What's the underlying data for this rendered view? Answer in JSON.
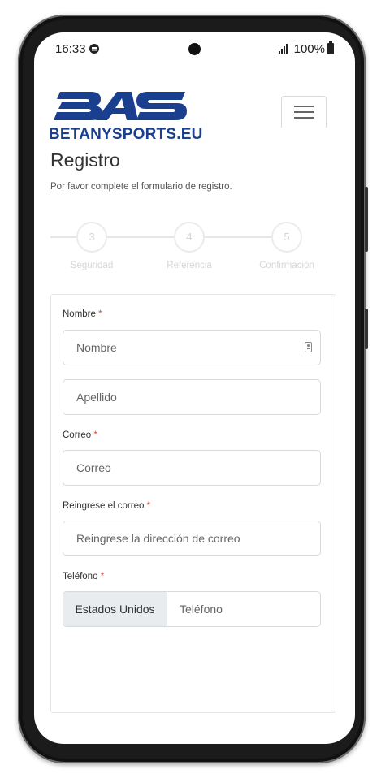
{
  "status_bar": {
    "time": "16:33",
    "battery": "100%"
  },
  "brand": {
    "logo_letters": "BAS",
    "name": "BETANYSPORTS.EU",
    "color": "#1a3f8f"
  },
  "page": {
    "title": "Registro",
    "subtitle": "Por favor complete el formulario de registro."
  },
  "steps": [
    {
      "number": "3",
      "label": "Seguridad"
    },
    {
      "number": "4",
      "label": "Referencia"
    },
    {
      "number": "5",
      "label": "Confirmación"
    }
  ],
  "form": {
    "required_mark": "*",
    "nombre": {
      "label": "Nombre",
      "placeholder": "Nombre"
    },
    "apellido": {
      "placeholder": "Apellido"
    },
    "correo": {
      "label": "Correo",
      "placeholder": "Correo"
    },
    "reingrese": {
      "label": "Reingrese el correo",
      "placeholder": "Reingrese la dirección de correo"
    },
    "telefono": {
      "label": "Teléfono",
      "country": "Estados Unidos",
      "placeholder": "Teléfono"
    }
  }
}
